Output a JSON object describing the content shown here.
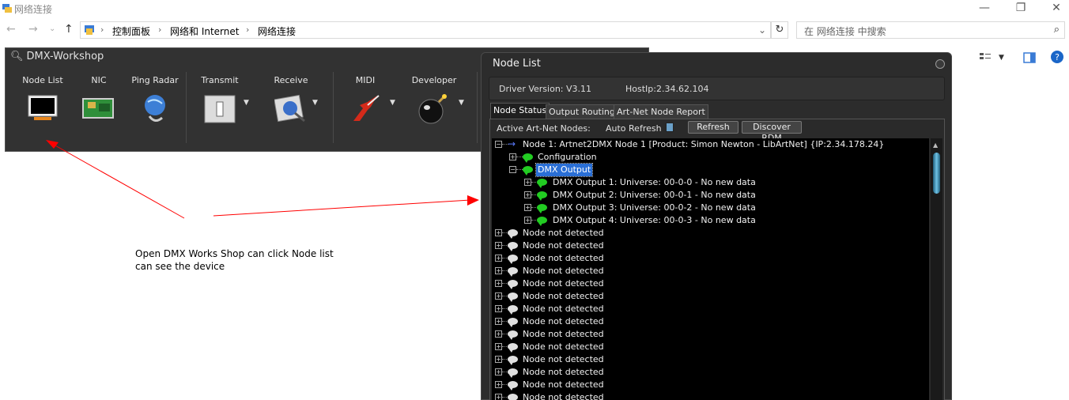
{
  "explorer": {
    "title": "网络连接",
    "breadcrumb": [
      "控制面板",
      "网络和 Internet",
      "网络连接"
    ],
    "search_placeholder": "在 网络连接 中搜索",
    "controls": {
      "minimize": "—",
      "maximize": "❐",
      "close": "✕"
    },
    "nav": {
      "back": "←",
      "forward": "→",
      "recent": "⌄",
      "up": "↑"
    },
    "refresh": "↻",
    "dropdown": "⌄"
  },
  "dmx": {
    "title": "DMX-Workshop",
    "tools": [
      {
        "label": "Node List",
        "icon": "monitor-icon"
      },
      {
        "label": "NIC",
        "icon": "network-card-icon"
      },
      {
        "label": "Ping Radar",
        "icon": "globe-icon"
      },
      {
        "label": "Transmit",
        "icon": "fader-icon"
      },
      {
        "label": "Receive",
        "icon": "scope-icon"
      },
      {
        "label": "MIDI",
        "icon": "guitar-icon"
      },
      {
        "label": "Developer",
        "icon": "bomb-icon"
      }
    ]
  },
  "annotation": {
    "line1": "Open DMX Works Shop can click Node list",
    "line2": "can see the device"
  },
  "node_list": {
    "title": "Node List",
    "driver_version": "Driver Version: V3.11",
    "host_ip": "HostIp:2.34.62.104",
    "tabs": [
      "Node Status",
      "Output Routing",
      "Art-Net Node Report"
    ],
    "active_nodes_label": "Active Art-Net Nodes:",
    "auto_refresh_label": "Auto Refresh",
    "refresh_button": "Refresh",
    "discover_button": "Discover RDM",
    "node1": "Node 1: Artnet2DMX Node 1 [Product: Simon Newton - LibArtNet] {IP:2.34.178.24}",
    "configuration": "Configuration",
    "dmx_output": "DMX Output",
    "outputs": [
      "DMX Output 1: Universe: 00-0-0  - No new data",
      "DMX Output 2: Universe: 00-0-1  - No new data",
      "DMX Output 3: Universe: 00-0-2  - No new data",
      "DMX Output 4: Universe: 00-0-3  - No new data"
    ],
    "not_detected": [
      "Node not detected",
      "Node not detected",
      "Node not detected",
      "Node not detected",
      "Node not detected",
      "Node not detected",
      "Node not detected",
      "Node not detected",
      "Node not detected",
      "Node not detected",
      "Node not detected",
      "Node not detected",
      "Node not detected",
      "Node not detected"
    ]
  },
  "colors": {
    "arrow": "#ff0000",
    "bubble_green": "#22cc22",
    "bubble_white": "#e0e0e0",
    "selection": "#2a6fd6"
  }
}
